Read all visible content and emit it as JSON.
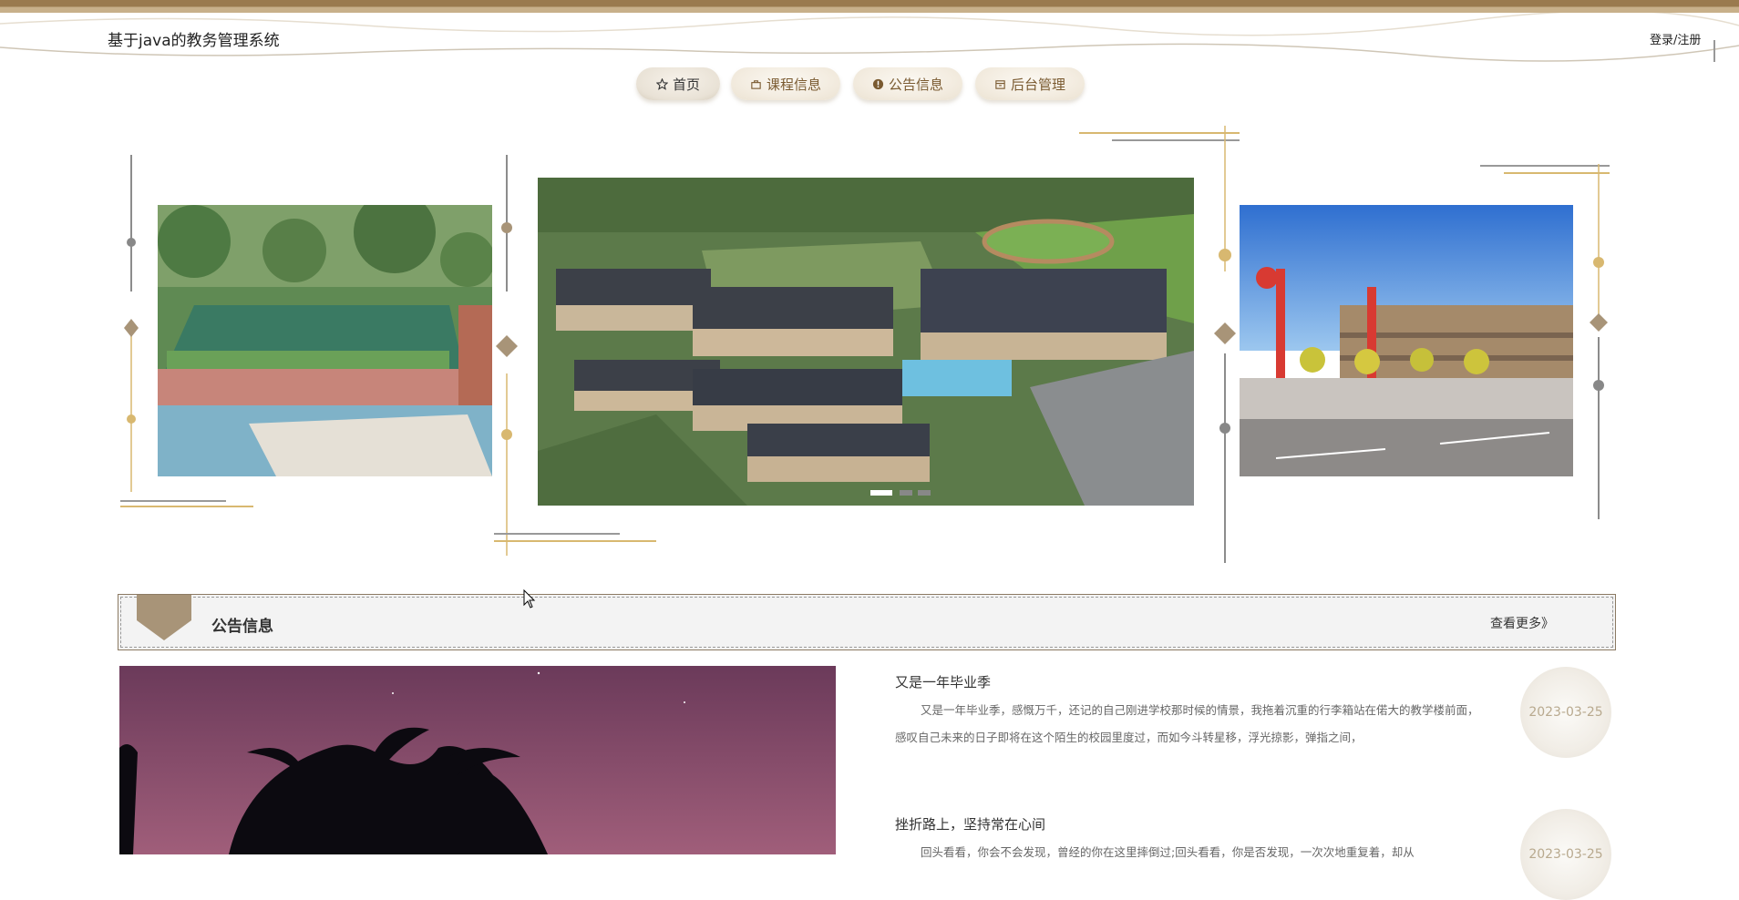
{
  "header": {
    "site_title": "基于java的教务管理系统",
    "login_label": "登录/注册"
  },
  "nav": {
    "items": [
      {
        "label": "首页",
        "icon": "star-icon",
        "active": true
      },
      {
        "label": "课程信息",
        "icon": "bag-icon",
        "active": false
      },
      {
        "label": "公告信息",
        "icon": "info-icon",
        "active": false
      },
      {
        "label": "后台管理",
        "icon": "box-icon",
        "active": false
      }
    ]
  },
  "carousel": {
    "slides": [
      "campus-rooftop-garden",
      "campus-aerial-view",
      "campus-playground-kites"
    ],
    "active_index": 0,
    "dot_count": 3
  },
  "notice_section": {
    "title": "公告信息",
    "more_label": "查看更多》",
    "items": [
      {
        "title": "又是一年毕业季",
        "text": "又是一年毕业季，感慨万千，还记的自己刚进学校那时候的情景，我拖着沉重的行李箱站在偌大的教学楼前面，感叹自己未来的日子即将在这个陌生的校园里度过，而如今斗转星移，浮光掠影，弹指之间，",
        "date": "2023-03-25"
      },
      {
        "title": "挫折路上，坚持常在心间",
        "text": "回头看看，你会不会发现，曾经的你在这里摔倒过;回头看看，你是否发现，一次次地重复着，却从",
        "date": "2023-03-25"
      }
    ]
  },
  "colors": {
    "accent": "#9a7a4e",
    "gold": "#d8b870",
    "gray_line": "#888888",
    "badge": "#a89478"
  }
}
